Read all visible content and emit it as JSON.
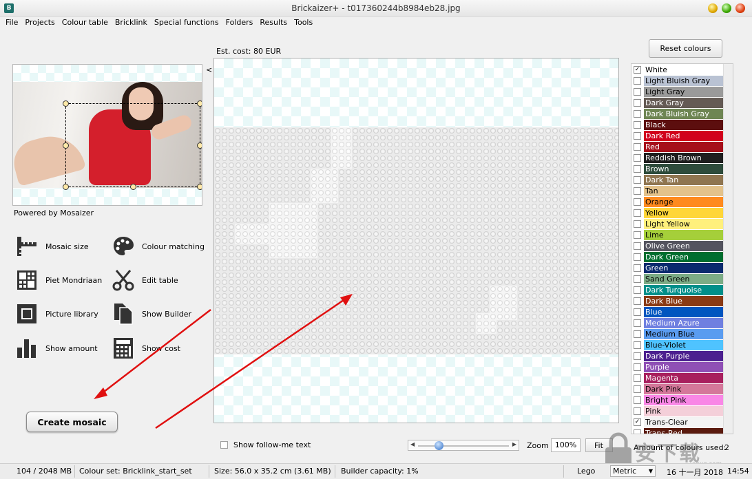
{
  "window": {
    "title": "Brickaizer+  - t017360244b8984eb28.jpg",
    "app_icon_letter": "B"
  },
  "menu": [
    "File",
    "Projects",
    "Colour table",
    "Bricklink",
    "Special functions",
    "Folders",
    "Results",
    "Tools"
  ],
  "preview": {
    "powered_by": "Powered by Mosaizer",
    "collapse_glyph": "<"
  },
  "tools": [
    {
      "label": "Mosaic size",
      "icon": "ruler-icon"
    },
    {
      "label": "Colour matching",
      "icon": "palette-icon"
    },
    {
      "label": "Piet Mondriaan",
      "icon": "grid-icon"
    },
    {
      "label": "Edit table",
      "icon": "scissors-icon"
    },
    {
      "label": "Picture library",
      "icon": "picture-frame-icon"
    },
    {
      "label": "Show Builder",
      "icon": "documents-icon"
    },
    {
      "label": "Show amount",
      "icon": "bar-chart-icon"
    },
    {
      "label": "Show cost",
      "icon": "calculator-icon"
    }
  ],
  "create_mosaic": "Create mosaic",
  "center": {
    "est_cost": "Est. cost:  80 EUR",
    "follow_me": "Show follow-me text",
    "zoom_label": "Zoom",
    "zoom_value": "100%",
    "zoom_level_fraction": 0.2,
    "fit_label": "Fit"
  },
  "right": {
    "reset_colours": "Reset colours",
    "colours": [
      {
        "name": "White",
        "color": "#ffffff",
        "checked": true,
        "text": "#000000"
      },
      {
        "name": "Light Bluish Gray",
        "color": "#b9c2d3",
        "checked": false,
        "text": "#000000"
      },
      {
        "name": "Light Gray",
        "color": "#9a9a9a",
        "checked": false,
        "text": "#000000"
      },
      {
        "name": "Dark Gray",
        "color": "#645a54",
        "checked": false,
        "text": "#ffffff"
      },
      {
        "name": "Dark Bluish Gray",
        "color": "#6e8553",
        "checked": false,
        "text": "#ffffff"
      },
      {
        "name": "Black",
        "color": "#5c0e0e",
        "checked": false,
        "text": "#ffffff"
      },
      {
        "name": "Dark Red",
        "color": "#d1001c",
        "checked": false,
        "text": "#ffffff"
      },
      {
        "name": "Red",
        "color": "#a60f1a",
        "checked": false,
        "text": "#ffffff"
      },
      {
        "name": "Reddish Brown",
        "color": "#1e1e1e",
        "checked": false,
        "text": "#ffffff"
      },
      {
        "name": "Brown",
        "color": "#2d4b3b",
        "checked": false,
        "text": "#ffffff"
      },
      {
        "name": "Dark Tan",
        "color": "#8f7550",
        "checked": false,
        "text": "#ffffff"
      },
      {
        "name": "Tan",
        "color": "#e3c28b",
        "checked": false,
        "text": "#000000"
      },
      {
        "name": "Orange",
        "color": "#ff8a1e",
        "checked": false,
        "text": "#000000"
      },
      {
        "name": "Yellow",
        "color": "#ffd638",
        "checked": false,
        "text": "#000000"
      },
      {
        "name": "Light Yellow",
        "color": "#fff07c",
        "checked": false,
        "text": "#000000"
      },
      {
        "name": "Lime",
        "color": "#a5cf3a",
        "checked": false,
        "text": "#000000"
      },
      {
        "name": "Olive Green",
        "color": "#53535e",
        "checked": false,
        "text": "#ffffff"
      },
      {
        "name": "Dark Green",
        "color": "#006e2f",
        "checked": false,
        "text": "#ffffff"
      },
      {
        "name": "Green",
        "color": "#0a2a6e",
        "checked": false,
        "text": "#ffffff"
      },
      {
        "name": "Sand Green",
        "color": "#7cac86",
        "checked": false,
        "text": "#000000"
      },
      {
        "name": "Dark Turquoise",
        "color": "#008f8a",
        "checked": false,
        "text": "#ffffff"
      },
      {
        "name": "Dark Blue",
        "color": "#8a3a14",
        "checked": false,
        "text": "#ffffff"
      },
      {
        "name": "Blue",
        "color": "#0055bf",
        "checked": false,
        "text": "#ffffff"
      },
      {
        "name": "Medium Azure",
        "color": "#6f7fe0",
        "checked": false,
        "text": "#ffffff"
      },
      {
        "name": "Medium Blue",
        "color": "#5a9cf0",
        "checked": false,
        "text": "#000000"
      },
      {
        "name": "Blue-Violet",
        "color": "#4fc3ff",
        "checked": false,
        "text": "#000000"
      },
      {
        "name": "Dark Purple",
        "color": "#4b1f8f",
        "checked": false,
        "text": "#ffffff"
      },
      {
        "name": "Purple",
        "color": "#8f4fb5",
        "checked": false,
        "text": "#ffffff"
      },
      {
        "name": "Magenta",
        "color": "#a8205e",
        "checked": false,
        "text": "#ffffff"
      },
      {
        "name": "Dark Pink",
        "color": "#d4789a",
        "checked": false,
        "text": "#000000"
      },
      {
        "name": "Bright Pink",
        "color": "#f987e6",
        "checked": false,
        "text": "#000000"
      },
      {
        "name": "Pink",
        "color": "#f4cfd9",
        "checked": false,
        "text": "#000000"
      },
      {
        "name": "Trans-Clear",
        "color": "#f3f3f3",
        "checked": true,
        "text": "#000000"
      },
      {
        "name": "Trans-Red",
        "color": "#5a1a0e",
        "checked": false,
        "text": "#ffffff"
      }
    ],
    "amount_label": "Amount of colours used:",
    "amount_value": "2"
  },
  "status": {
    "memory": "104 / 2048 MB",
    "colour_set": "Colour set: Bricklink_start_set",
    "size": "Size: 56.0 x 35.2 cm (3.61 MB)",
    "capacity": "Builder capacity: 1%",
    "brand": "Lego",
    "units": "Metric",
    "date": "16 十一月 2018",
    "time": "14:54"
  },
  "watermark": {
    "text": "安下载",
    "url": "anxz.com"
  },
  "accent": {
    "arrow_red": "#e01010",
    "zoom_thumb": "#5b8fd6"
  }
}
